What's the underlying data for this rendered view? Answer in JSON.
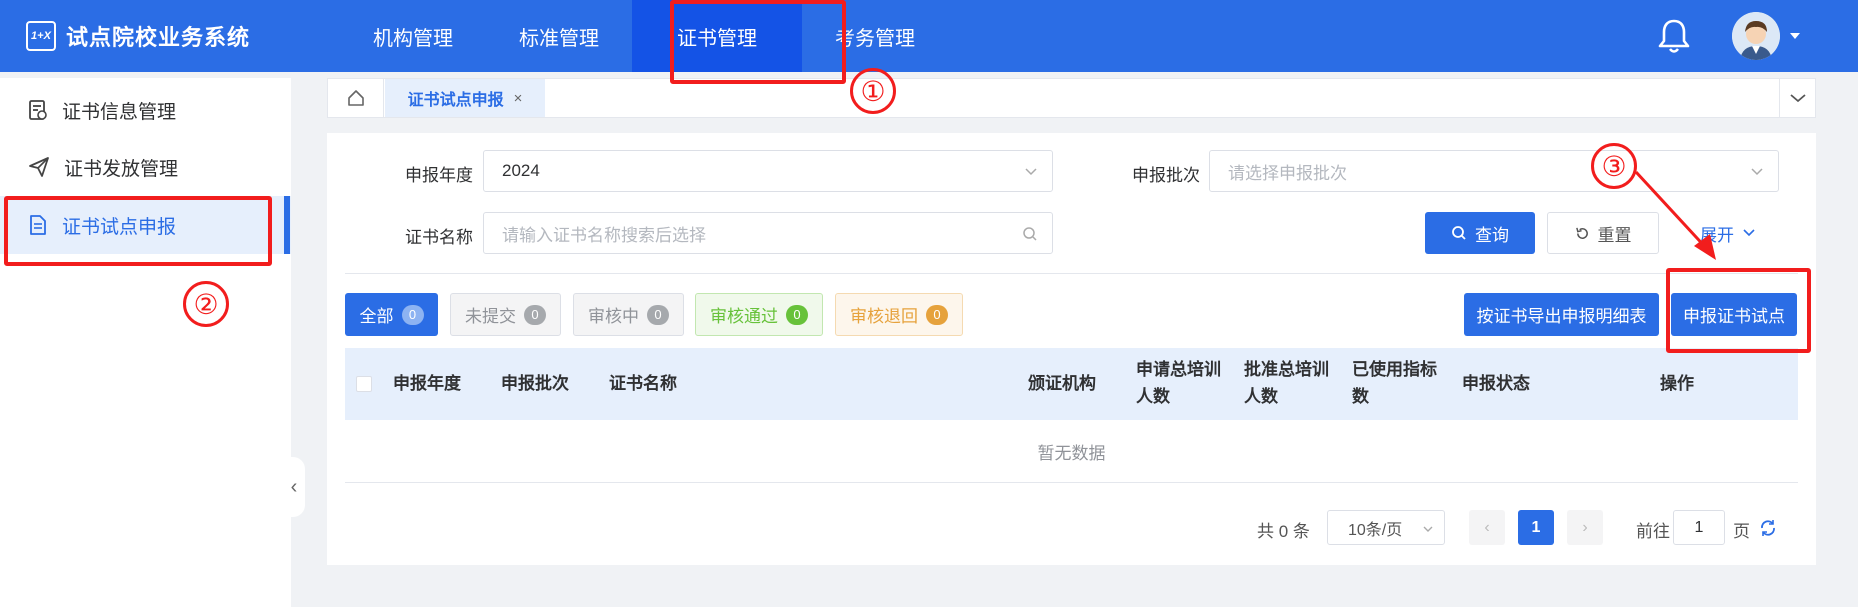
{
  "header": {
    "logo_mark": "1+X",
    "title": "试点院校业务系统",
    "nav": [
      {
        "label": "机构管理"
      },
      {
        "label": "标准管理"
      },
      {
        "label": "证书管理"
      },
      {
        "label": "考务管理"
      }
    ]
  },
  "sidebar": {
    "items": [
      {
        "label": "证书信息管理"
      },
      {
        "label": "证书发放管理"
      },
      {
        "label": "证书试点申报"
      }
    ]
  },
  "tabs": {
    "current": "证书试点申报",
    "close": "×"
  },
  "filters": {
    "year_label": "申报年度",
    "year_value": "2024",
    "batch_label": "申报批次",
    "batch_placeholder": "请选择申报批次",
    "cert_label": "证书名称",
    "cert_placeholder": "请输入证书名称搜索后选择",
    "search_btn": "查询",
    "reset_btn": "重置",
    "expand_btn": "展开"
  },
  "status_tabs": [
    {
      "label": "全部",
      "count": "0",
      "color": "#2b6de5"
    },
    {
      "label": "未提交",
      "count": "0",
      "color": "#909399"
    },
    {
      "label": "审核中",
      "count": "0",
      "color": "#909399"
    },
    {
      "label": "审核通过",
      "count": "0",
      "color": "#67c23a"
    },
    {
      "label": "审核退回",
      "count": "0",
      "color": "#e6a23c"
    }
  ],
  "actions": {
    "export_btn": "按证书导出申报明细表",
    "apply_btn": "申报证书试点"
  },
  "table": {
    "columns": [
      "申报年度",
      "申报批次",
      "证书名称",
      "颁证机构",
      "申请总培训",
      "人数",
      "批准总培训",
      "人数",
      "已使用指标",
      "数",
      "申报状态",
      "操作"
    ],
    "empty_text": "暂无数据"
  },
  "pagination": {
    "total": "共 0 条",
    "page_size": "10条/页",
    "current_page": "1",
    "goto_label": "前往",
    "goto_value": "1",
    "page_unit": "页"
  },
  "annotations": [
    "①",
    "②",
    "③"
  ]
}
